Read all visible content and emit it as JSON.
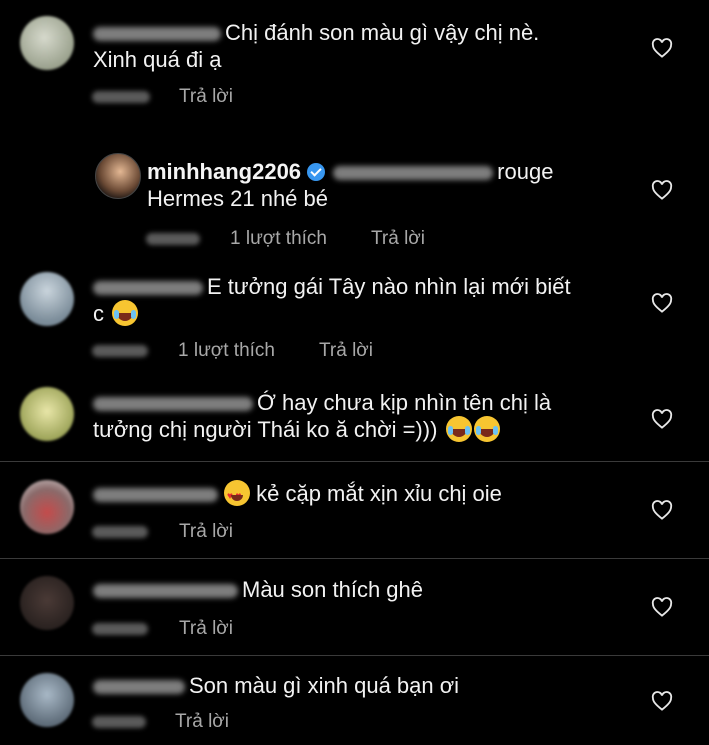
{
  "comments": [
    {
      "text_lines": [
        "Chị đánh son màu gì vậy chị nè.",
        "Xinh quá đi ạ"
      ],
      "reply_label": "Trả lời"
    },
    {
      "author": "minhhang2206",
      "text_lines": [
        "rouge",
        "Hermes 21 nhé bé"
      ],
      "likes_label": "1 lượt thích",
      "reply_label": "Trả lời"
    },
    {
      "text_lines": [
        "E tưởng gái Tây nào nhìn lại mới biết",
        "c"
      ],
      "likes_label": "1 lượt thích",
      "reply_label": "Trả lời"
    },
    {
      "text_lines": [
        "Ớ hay chưa kịp nhìn tên chị là",
        "tưởng chị người Thái ko ă chời =)))"
      ]
    },
    {
      "text_lines": [
        "kẻ cặp mắt xịn xỉu chị oie"
      ],
      "reply_label": "Trả lời"
    },
    {
      "text_lines": [
        "Màu son thích ghê"
      ],
      "reply_label": "Trả lời"
    },
    {
      "text_lines": [
        "Son màu gì xinh quá bạn ơi"
      ],
      "reply_label": "Trả lời"
    }
  ],
  "icons": {
    "like": "heart-outline-icon",
    "verified": "verified-badge-icon",
    "laugh": "face-with-tears-of-joy-emoji",
    "heart_eyes": "heart-eyes-emoji"
  },
  "colors": {
    "background": "#000000",
    "text": "#f2f2f2",
    "meta_text": "#a8a8a8",
    "verified": "#3897f0"
  }
}
